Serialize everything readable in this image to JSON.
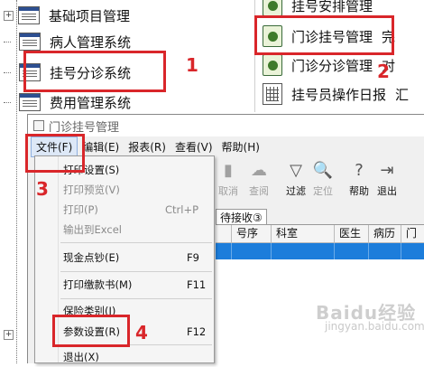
{
  "tree": {
    "items": [
      {
        "label": "基础项目管理"
      },
      {
        "label": "病人管理系统"
      },
      {
        "label": "挂号分诊系统"
      },
      {
        "label": "费用管理系统"
      }
    ]
  },
  "right_panel": {
    "items": [
      {
        "label": "挂号安排管理",
        "extra": ""
      },
      {
        "label": "门诊挂号管理",
        "extra": "完"
      },
      {
        "label": "门诊分诊管理",
        "extra": "对"
      },
      {
        "label": "挂号员操作日报",
        "extra": "汇"
      }
    ]
  },
  "window": {
    "title": "门诊挂号管理",
    "menus": [
      "文件(F)",
      "编辑(E)",
      "报表(R)",
      "查看(V)",
      "帮助(H)"
    ],
    "toolbar": [
      {
        "label": "取消",
        "icon": "cancel-icon",
        "disabled": true
      },
      {
        "label": "查阅",
        "icon": "view-icon",
        "disabled": true
      },
      {
        "label": "过滤",
        "icon": "filter-icon",
        "disabled": false
      },
      {
        "label": "定位",
        "icon": "locate-icon",
        "disabled": true
      },
      {
        "label": "帮助",
        "icon": "help-icon",
        "disabled": false
      },
      {
        "label": "退出",
        "icon": "exit-icon",
        "disabled": false
      }
    ],
    "tab": "待接收③",
    "grid_columns": [
      "号序",
      "科室",
      "医生",
      "病历",
      "门"
    ]
  },
  "file_menu": {
    "items": [
      {
        "label": "打印设置(S)",
        "shortcut": "",
        "disabled": false
      },
      {
        "label": "打印预览(V)",
        "shortcut": "",
        "disabled": true
      },
      {
        "label": "打印(P)",
        "shortcut": "Ctrl+P",
        "disabled": true
      },
      {
        "label": "输出到Excel",
        "shortcut": "",
        "disabled": true
      },
      {
        "label": "现金点钞(E)",
        "shortcut": "F9",
        "disabled": false
      },
      {
        "label": "打印缴款书(M)",
        "shortcut": "F11",
        "disabled": false
      },
      {
        "label": "保险类别(I)",
        "shortcut": "",
        "disabled": false
      },
      {
        "label": "参数设置(R)",
        "shortcut": "F12",
        "disabled": false
      },
      {
        "label": "退出(X)",
        "shortcut": "",
        "disabled": false
      }
    ]
  },
  "annotations": {
    "steps": [
      "1",
      "2",
      "3",
      "4"
    ],
    "color": "#d9262a"
  },
  "colors": {
    "selection_row": "#1c7ddb"
  },
  "watermark": {
    "brand": "Baidu经验",
    "url": "jingyan.baidu.com"
  }
}
